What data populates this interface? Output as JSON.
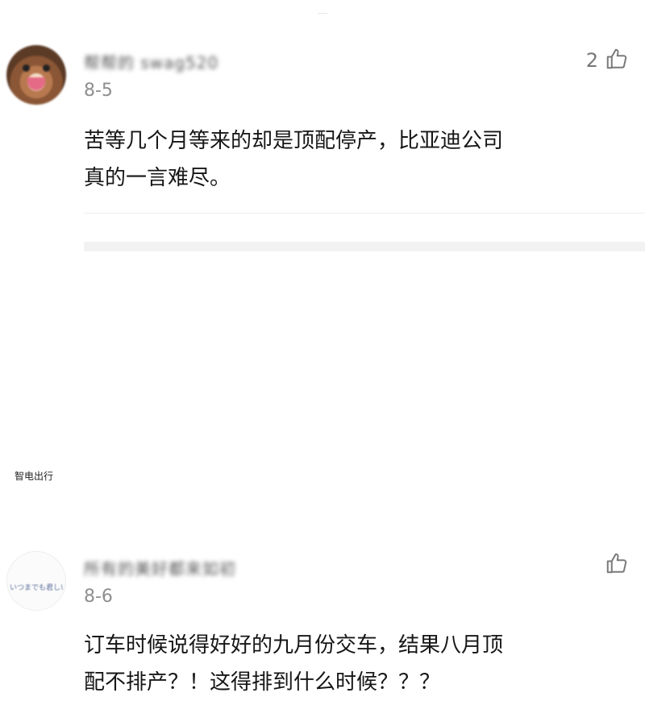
{
  "comments": [
    {
      "username": "帮帮的 swag520",
      "date": "8-5",
      "text_line1": "苦等几个月等来的却是顶配停产，比亚迪公司",
      "text_line2": "真的一言难尽。",
      "like_count": "2"
    },
    {
      "username": "所有的美好都来如初",
      "avatar_text": "いつまでも君しい",
      "date": "8-6",
      "text_line1": "订车时候说得好好的九月份交车，结果八月顶",
      "text_line2": "配不排产？！这得排到什么时候？？？",
      "like_count": ""
    }
  ],
  "watermark": "智电出行",
  "colors": {
    "text": "#161616",
    "muted": "#8e8e8e",
    "divider": "#eeeeee"
  }
}
